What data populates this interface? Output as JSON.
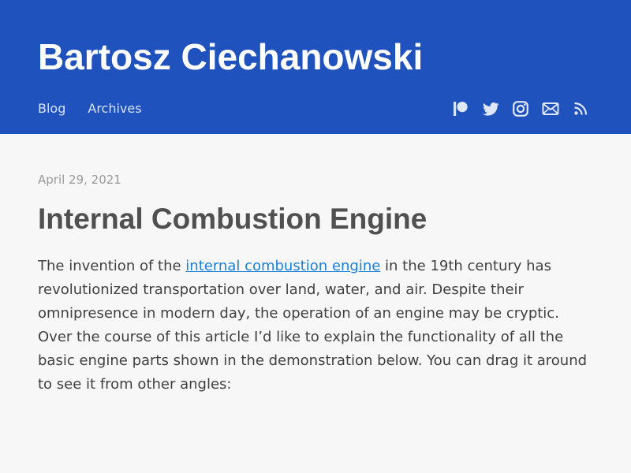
{
  "header": {
    "site_title": "Bartosz Ciechanowski",
    "nav": [
      {
        "label": "Blog"
      },
      {
        "label": "Archives"
      }
    ],
    "social_icons": [
      "patreon-icon",
      "twitter-icon",
      "instagram-icon",
      "mail-icon",
      "rss-icon"
    ],
    "background_color": "#1f52bd"
  },
  "post": {
    "date": "April 29, 2021",
    "title": "Internal Combustion Engine",
    "intro_before_link": "The invention of the ",
    "intro_link": "internal combustion engine",
    "intro_after_link": " in the 19th century has revolutionized transportation over land, water, and air. Despite their omnipresence in modern day, the operation of an engine may be cryptic. Over the course of this article I’d like to explain the functionality of all the basic engine parts shown in the demonstration below. You can drag it around to see it from other angles:",
    "link_color": "#1a7fd6"
  }
}
